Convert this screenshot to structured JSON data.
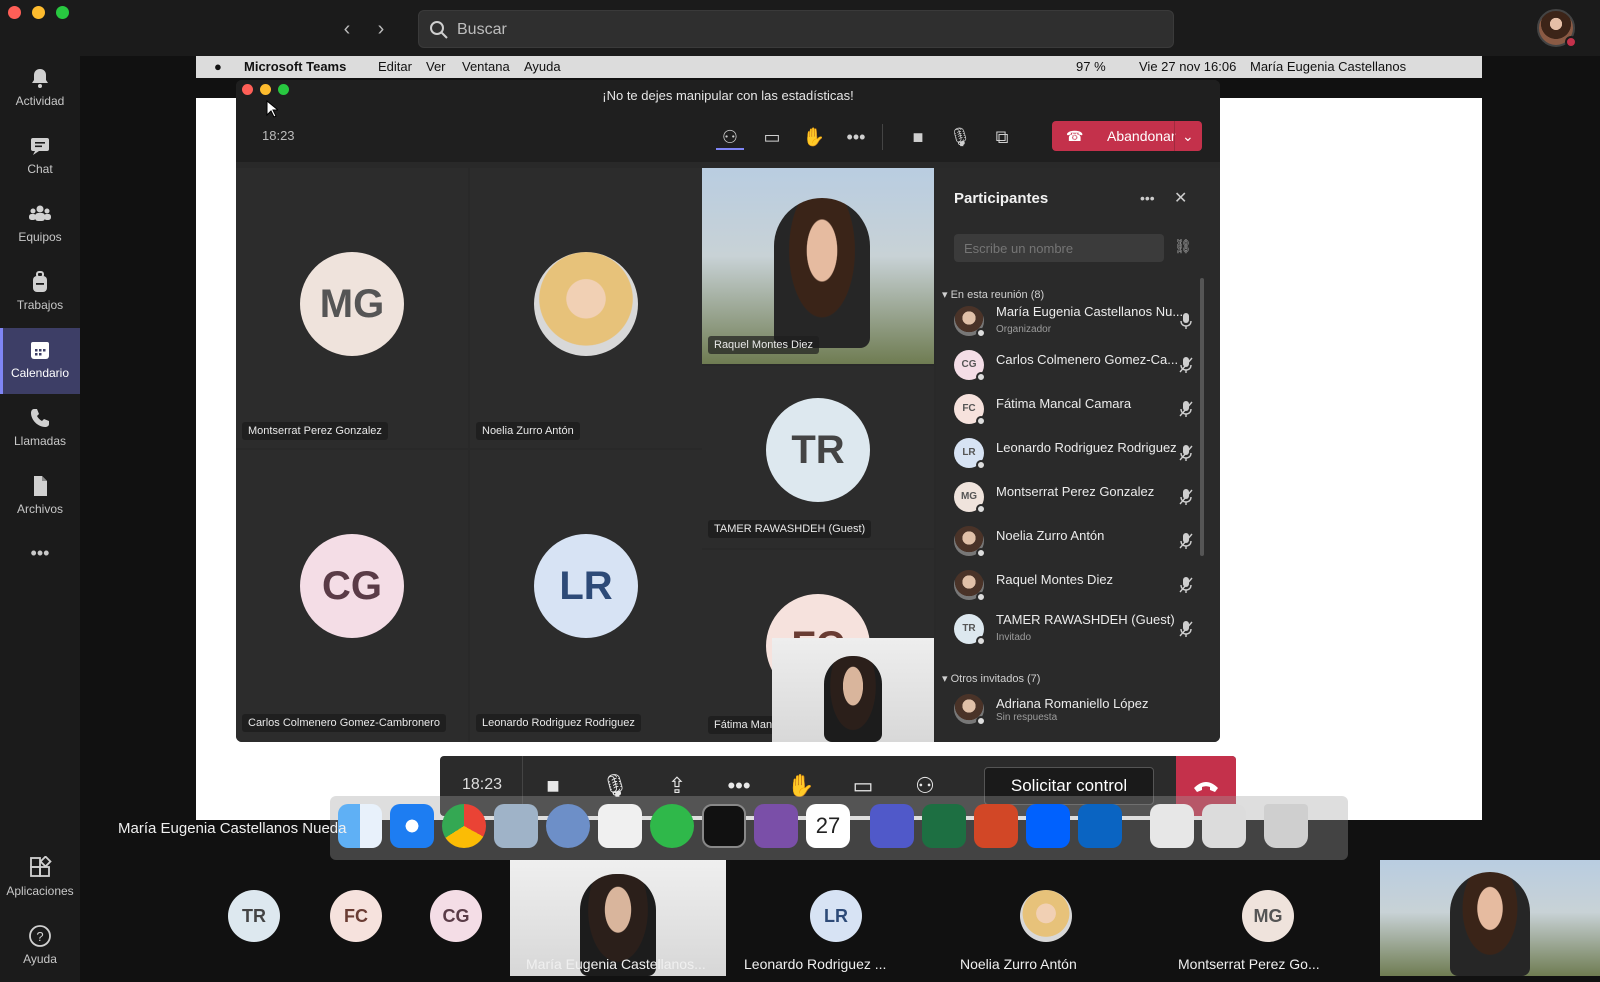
{
  "search": {
    "placeholder": "Buscar"
  },
  "rail": {
    "items": [
      {
        "label": "Actividad",
        "icon": "bell-icon"
      },
      {
        "label": "Chat",
        "icon": "chat-icon"
      },
      {
        "label": "Equipos",
        "icon": "teams-icon"
      },
      {
        "label": "Trabajos",
        "icon": "backpack-icon"
      },
      {
        "label": "Calendario",
        "icon": "calendar-icon",
        "active": true
      },
      {
        "label": "Llamadas",
        "icon": "phone-icon"
      },
      {
        "label": "Archivos",
        "icon": "file-icon"
      }
    ],
    "more": "•••",
    "apps_label": "Aplicaciones",
    "help_label": "Ayuda"
  },
  "mac_menubar": {
    "app": "Microsoft Teams",
    "menus": [
      "Editar",
      "Ver",
      "Ventana",
      "Ayuda"
    ],
    "battery": "97 %",
    "datetime": "Vie 27 nov  16:06",
    "user": "María Eugenia Castellanos"
  },
  "meeting": {
    "title": "¡No te dejes manipular con las estadísticas!",
    "time": "18:23",
    "leave_label": "Abandonar",
    "tiles": [
      {
        "initials": "MG",
        "name": "Montserrat Perez Gonzalez"
      },
      {
        "initials": "",
        "name": "Noelia Zurro Antón"
      },
      {
        "initials": "",
        "name": "Raquel Montes Diez"
      },
      {
        "initials": "TR",
        "name": "TAMER RAWASHDEH (Guest)"
      },
      {
        "initials": "CG",
        "name": "Carlos Colmenero Gomez-Cambronero"
      },
      {
        "initials": "LR",
        "name": "Leonardo Rodriguez Rodriguez"
      },
      {
        "initials": "FC",
        "name": "Fátima Manc"
      }
    ]
  },
  "participants": {
    "title": "Participantes",
    "search_placeholder": "Escribe un nombre",
    "in_meeting_label": "En esta reunión (8)",
    "others_label": "Otros invitados (7)",
    "list": [
      {
        "initials": "",
        "name": "María Eugenia Castellanos Nu...",
        "sub": "Organizador"
      },
      {
        "initials": "CG",
        "name": "Carlos Colmenero Gomez-Ca...",
        "sub": ""
      },
      {
        "initials": "FC",
        "name": "Fátima Mancal Camara",
        "sub": ""
      },
      {
        "initials": "LR",
        "name": "Leonardo Rodriguez Rodriguez",
        "sub": ""
      },
      {
        "initials": "MG",
        "name": "Montserrat Perez Gonzalez",
        "sub": ""
      },
      {
        "initials": "",
        "name": "Noelia Zurro Antón",
        "sub": ""
      },
      {
        "initials": "",
        "name": "Raquel Montes Diez",
        "sub": ""
      },
      {
        "initials": "TR",
        "name": "TAMER RAWASHDEH (Guest)",
        "sub": "Invitado"
      }
    ],
    "others": [
      {
        "initials": "",
        "name": "Adriana Romaniello López",
        "sub": "Sin respuesta"
      }
    ]
  },
  "control_bar": {
    "time": "18:23",
    "request_control": "Solicitar control"
  },
  "presenter_name": "María Eugenia Castellanos Nueda",
  "dock": {
    "calendar_day": "27"
  },
  "gallery": {
    "items": [
      {
        "initials": "TR",
        "name": ""
      },
      {
        "initials": "FC",
        "name": ""
      },
      {
        "initials": "CG",
        "name": ""
      },
      {
        "initials": "",
        "name": "María Eugenia Castellanos..."
      },
      {
        "initials": "LR",
        "name": "Leonardo Rodriguez ..."
      },
      {
        "initials": "",
        "name": "Noelia Zurro Antón"
      },
      {
        "initials": "MG",
        "name": "Montserrat Perez Go..."
      }
    ]
  },
  "colors": {
    "accent": "#7f85f5",
    "leave": "#c4314b",
    "avatar_mg": "#efe3dc",
    "avatar_cg": "#f4dde6",
    "avatar_lr": "#d7e3f4",
    "avatar_tr": "#dde8ef",
    "avatar_fc": "#f6e2dd"
  }
}
